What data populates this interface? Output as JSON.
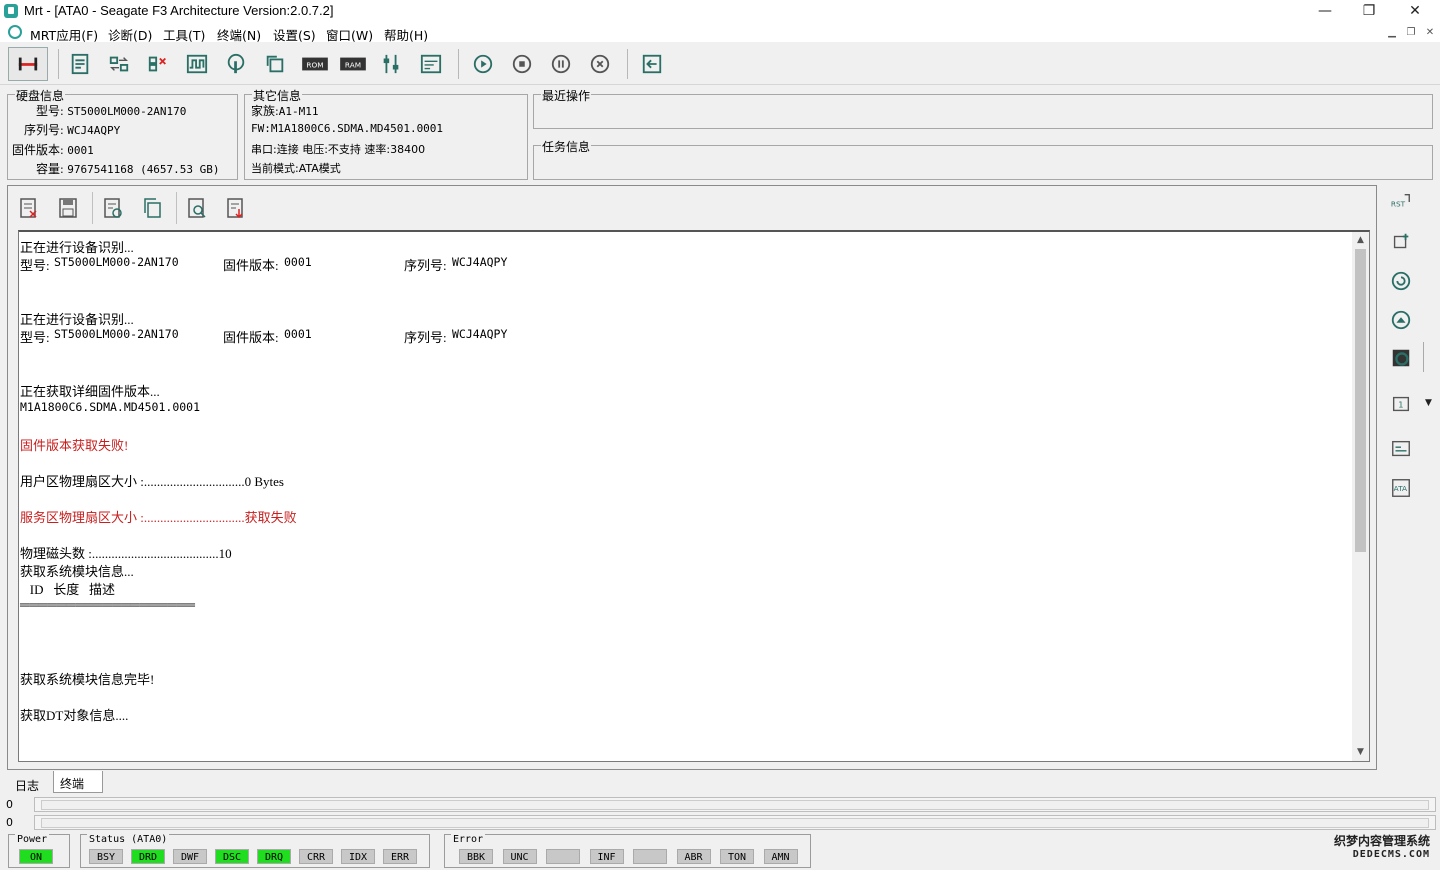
{
  "window": {
    "title": "Mrt - [ATA0 - Seagate F3 Architecture Version:2.0.7.2]",
    "minimize": "—",
    "maximize": "❐",
    "close": "✕"
  },
  "menu": {
    "items": [
      "MRT应用(F)",
      "诊断(D)",
      "工具(T)",
      "终端(N)",
      "设置(S)",
      "窗口(W)",
      "帮助(H)"
    ]
  },
  "toolbar": {
    "buttons": [
      "connect",
      "report",
      "transfer",
      "compare",
      "waveform",
      "touch",
      "refresh-copy",
      "ROM",
      "RAM",
      "adjust",
      "terminal",
      "play",
      "stop",
      "pause",
      "cancel",
      "exit"
    ],
    "rom_label": "ROM",
    "ram_label": "RAM"
  },
  "disk_info": {
    "title": "硬盘信息",
    "model_label": "型号",
    "model": "ST5000LM000-2AN170",
    "serial_label": "序列号",
    "serial": "WCJ4AQPY",
    "fw_label": "固件版本",
    "fw": "0001",
    "capacity_label": "容量",
    "capacity": "9767541168 (4657.53 GB)"
  },
  "other_info": {
    "title": "其它信息",
    "family_label": "家族",
    "family": "A1-M11",
    "fw_full": "FW:M1A1800C6.SDMA.MD4501.0001",
    "port_text": "串口:连接 电压:不支持 速率:38400",
    "mode_text": "当前模式:ATA模式"
  },
  "recent_ops": {
    "title": "最近操作"
  },
  "task_info": {
    "title": "任务信息"
  },
  "log": {
    "lines": [
      {
        "text": "正在进行设备识别...",
        "color": "black"
      },
      {
        "seg": [
          "型号:",
          "ST5000LM000-2AN170",
          "固件版本:",
          "0001",
          "序列号:",
          "WCJ4AQPY"
        ]
      },
      {
        "text": "",
        "color": "black"
      },
      {
        "text": "",
        "color": "black"
      },
      {
        "text": "正在进行设备识别...",
        "color": "black"
      },
      {
        "seg": [
          "型号:",
          "ST5000LM000-2AN170",
          "固件版本:",
          "0001",
          "序列号:",
          "WCJ4AQPY"
        ]
      },
      {
        "text": "",
        "color": "black"
      },
      {
        "text": "",
        "color": "black"
      },
      {
        "text": "正在获取详细固件版本...",
        "color": "black"
      },
      {
        "text": "M1A1800C6.SDMA.MD4501.0001",
        "color": "black",
        "mono": true
      },
      {
        "text": "",
        "color": "black"
      },
      {
        "text": "固件版本获取失败!",
        "color": "red"
      },
      {
        "text": "",
        "color": "black"
      },
      {
        "text": "用户区物理扇区大小 :...............................0 Bytes",
        "color": "black"
      },
      {
        "text": "",
        "color": "black"
      },
      {
        "text": "服务区物理扇区大小 :...............................获取失败",
        "color": "red"
      },
      {
        "text": "",
        "color": "black"
      },
      {
        "text": "物理磁头数 :.......................................10",
        "color": "black"
      },
      {
        "text": "获取系统模块信息...",
        "color": "black"
      },
      {
        "text": "   ID   长度   描述",
        "color": "black"
      },
      {
        "text": "═══════════════════",
        "color": "black"
      },
      {
        "text": "",
        "color": "black"
      },
      {
        "text": "",
        "color": "black"
      },
      {
        "text": "",
        "color": "black"
      },
      {
        "text": "获取系统模块信息完毕!",
        "color": "black"
      },
      {
        "text": "",
        "color": "black"
      },
      {
        "text": "获取DT对象信息....",
        "color": "black"
      }
    ]
  },
  "tabs": [
    "日志",
    "终端"
  ],
  "progress": [
    "0",
    "0"
  ],
  "status": {
    "power_title": "Power",
    "power_leds": [
      {
        "label": "ON",
        "on": true
      }
    ],
    "status_title": "Status (ATA0)",
    "status_leds": [
      {
        "label": "BSY",
        "on": false
      },
      {
        "label": "DRD",
        "on": true
      },
      {
        "label": "DWF",
        "on": false
      },
      {
        "label": "DSC",
        "on": true
      },
      {
        "label": "DRQ",
        "on": true
      },
      {
        "label": "CRR",
        "on": false
      },
      {
        "label": "IDX",
        "on": false
      },
      {
        "label": "ERR",
        "on": false
      }
    ],
    "error_title": "Error",
    "error_leds": [
      {
        "label": "BBK",
        "on": false
      },
      {
        "label": "UNC",
        "on": false
      },
      {
        "label": "",
        "on": false
      },
      {
        "label": "INF",
        "on": false
      },
      {
        "label": "",
        "on": false
      },
      {
        "label": "ABR",
        "on": false
      },
      {
        "label": "TON",
        "on": false
      },
      {
        "label": "AMN",
        "on": false
      }
    ]
  },
  "watermark": {
    "line1": "织梦内容管理系统",
    "line2": "DEDECMS.COM"
  },
  "colors": {
    "led_on": "#20dd20",
    "led_off": "#c8c8c8",
    "error_text": "#c81e1e",
    "icon": "#2a6f66"
  }
}
